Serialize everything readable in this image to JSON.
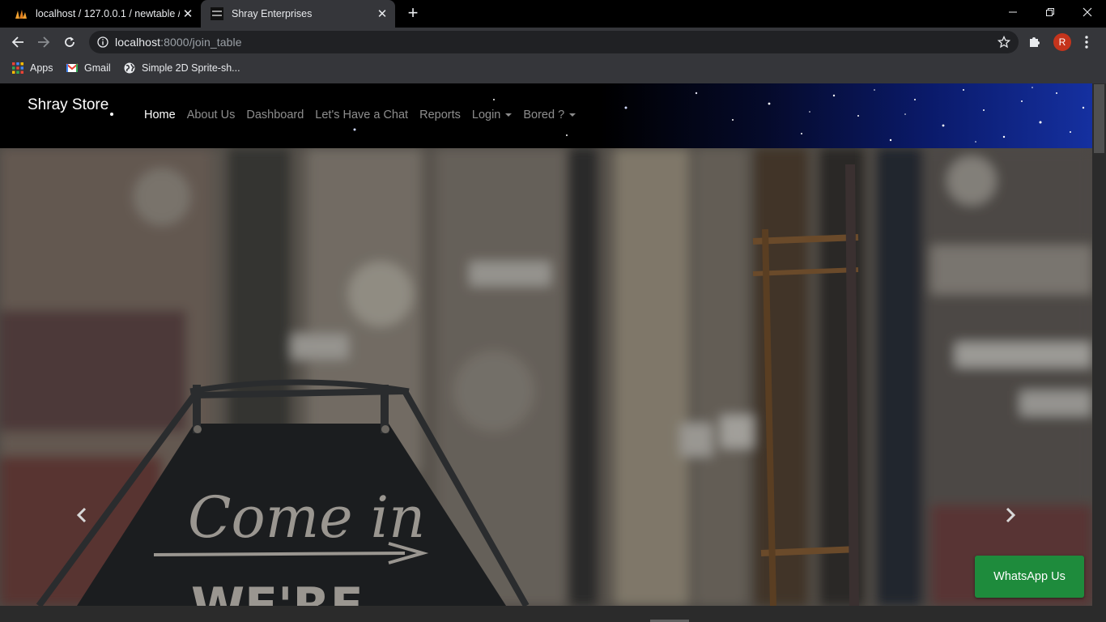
{
  "browser": {
    "tabs": [
      {
        "title": "localhost / 127.0.0.1 / newtable /",
        "icon": "phpmyadmin-icon",
        "active": false
      },
      {
        "title": "Shray Enterprises",
        "icon": "site-favicon",
        "active": true
      }
    ],
    "address": {
      "host": "localhost",
      "path": ":8000/join_table"
    },
    "avatar_letter": "R",
    "bookmarks": [
      {
        "label": "Apps",
        "icon": "apps-grid-icon"
      },
      {
        "label": "Gmail",
        "icon": "gmail-icon"
      },
      {
        "label": "Simple 2D Sprite-sh...",
        "icon": "globe-icon"
      }
    ]
  },
  "site": {
    "brand": "Shray Store",
    "nav": [
      {
        "label": "Home",
        "active": true
      },
      {
        "label": "About Us"
      },
      {
        "label": "Dashboard"
      },
      {
        "label": "Let's Have a Chat"
      },
      {
        "label": "Reports"
      },
      {
        "label": "Login",
        "dropdown": true
      },
      {
        "label": "Bored ?",
        "dropdown": true
      }
    ],
    "hero": {
      "sign_line1": "Come in",
      "sign_line2": "WE'RE"
    },
    "whatsapp_button": "WhatsApp Us"
  },
  "colors": {
    "whatsapp": "#1e8b3c",
    "avatar": "#c5341c",
    "navbar_glow": "#1530a0"
  }
}
